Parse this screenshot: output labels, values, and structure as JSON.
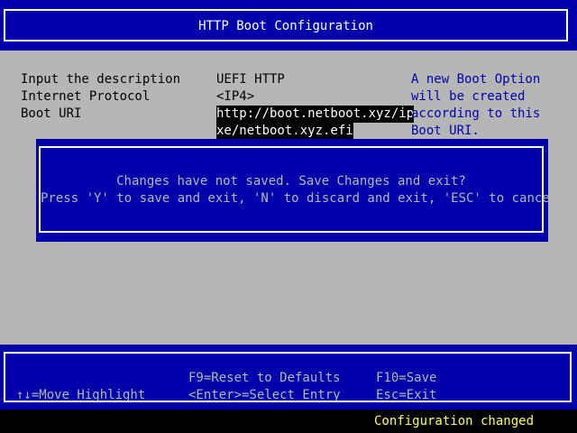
{
  "header": {
    "title": "HTTP Boot Configuration"
  },
  "form": {
    "description": {
      "label": "Input the description",
      "value": "UEFI HTTP"
    },
    "protocol": {
      "label": "Internet Protocol",
      "value": "<IP4>"
    },
    "boot_uri": {
      "label": "Boot URI",
      "value_line1": "http://boot.netboot.xyz/ip",
      "value_line2": "xe/netboot.xyz.efi"
    }
  },
  "help": {
    "line1": "A new Boot Option",
    "line2": "will be created",
    "line3": "according to this",
    "line4": "Boot URI."
  },
  "dialog": {
    "line1": "Changes have not saved. Save Changes and exit?",
    "line2": "Press 'Y' to save and exit, 'N' to discard and exit, 'ESC' to cancel."
  },
  "footer": {
    "move_highlight": "↑↓=Move Highlight",
    "reset_defaults": "F9=Reset to Defaults",
    "select_entry": "<Enter>=Select Entry",
    "save": "F10=Save",
    "exit": "Esc=Exit"
  },
  "status": {
    "text": "Configuration changed"
  },
  "colors": {
    "background": "#b6b6b6",
    "accent_blue": "#0000aa",
    "highlight_bg": "#000000",
    "status_text": "#ffff55"
  }
}
